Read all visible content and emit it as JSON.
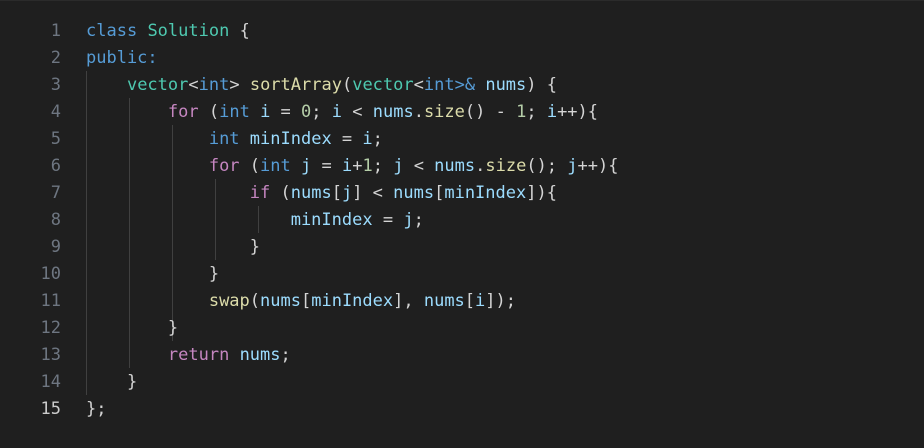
{
  "editor": {
    "language": "cpp",
    "active_line": 15,
    "lines": [
      {
        "number": "1",
        "tokens": [
          {
            "t": "class",
            "c": "kw"
          },
          {
            "t": " ",
            "c": "pun"
          },
          {
            "t": "Solution",
            "c": "typ"
          },
          {
            "t": " {",
            "c": "pun"
          }
        ]
      },
      {
        "number": "2",
        "tokens": [
          {
            "t": "public:",
            "c": "kw"
          }
        ]
      },
      {
        "number": "3",
        "tokens": [
          {
            "t": "    ",
            "c": "pun"
          },
          {
            "t": "vector",
            "c": "typ"
          },
          {
            "t": "<",
            "c": "pun"
          },
          {
            "t": "int",
            "c": "kw"
          },
          {
            "t": "> ",
            "c": "pun"
          },
          {
            "t": "sortArray",
            "c": "fn"
          },
          {
            "t": "(",
            "c": "pun"
          },
          {
            "t": "vector",
            "c": "typ"
          },
          {
            "t": "<",
            "c": "pun"
          },
          {
            "t": "int",
            "c": "kw"
          },
          {
            "t": ">&",
            "c": "kw"
          },
          {
            "t": " ",
            "c": "pun"
          },
          {
            "t": "nums",
            "c": "var"
          },
          {
            "t": ") {",
            "c": "pun"
          }
        ]
      },
      {
        "number": "4",
        "tokens": [
          {
            "t": "        ",
            "c": "pun"
          },
          {
            "t": "for",
            "c": "ctl"
          },
          {
            "t": " (",
            "c": "pun"
          },
          {
            "t": "int",
            "c": "kw"
          },
          {
            "t": " ",
            "c": "pun"
          },
          {
            "t": "i",
            "c": "var"
          },
          {
            "t": " = ",
            "c": "pun"
          },
          {
            "t": "0",
            "c": "num"
          },
          {
            "t": "; ",
            "c": "pun"
          },
          {
            "t": "i",
            "c": "var"
          },
          {
            "t": " < ",
            "c": "pun"
          },
          {
            "t": "nums",
            "c": "var"
          },
          {
            "t": ".",
            "c": "pun"
          },
          {
            "t": "size",
            "c": "fn"
          },
          {
            "t": "() - ",
            "c": "pun"
          },
          {
            "t": "1",
            "c": "num"
          },
          {
            "t": "; ",
            "c": "pun"
          },
          {
            "t": "i",
            "c": "var"
          },
          {
            "t": "++){",
            "c": "pun"
          }
        ]
      },
      {
        "number": "5",
        "tokens": [
          {
            "t": "            ",
            "c": "pun"
          },
          {
            "t": "int",
            "c": "kw"
          },
          {
            "t": " ",
            "c": "pun"
          },
          {
            "t": "minIndex",
            "c": "var"
          },
          {
            "t": " = ",
            "c": "pun"
          },
          {
            "t": "i",
            "c": "var"
          },
          {
            "t": ";",
            "c": "pun"
          }
        ]
      },
      {
        "number": "6",
        "tokens": [
          {
            "t": "            ",
            "c": "pun"
          },
          {
            "t": "for",
            "c": "ctl"
          },
          {
            "t": " (",
            "c": "pun"
          },
          {
            "t": "int",
            "c": "kw"
          },
          {
            "t": " ",
            "c": "pun"
          },
          {
            "t": "j",
            "c": "var"
          },
          {
            "t": " = ",
            "c": "pun"
          },
          {
            "t": "i",
            "c": "var"
          },
          {
            "t": "+",
            "c": "pun"
          },
          {
            "t": "1",
            "c": "num"
          },
          {
            "t": "; ",
            "c": "pun"
          },
          {
            "t": "j",
            "c": "var"
          },
          {
            "t": " < ",
            "c": "pun"
          },
          {
            "t": "nums",
            "c": "var"
          },
          {
            "t": ".",
            "c": "pun"
          },
          {
            "t": "size",
            "c": "fn"
          },
          {
            "t": "(); ",
            "c": "pun"
          },
          {
            "t": "j",
            "c": "var"
          },
          {
            "t": "++){",
            "c": "pun"
          }
        ]
      },
      {
        "number": "7",
        "tokens": [
          {
            "t": "                ",
            "c": "pun"
          },
          {
            "t": "if",
            "c": "ctl"
          },
          {
            "t": " (",
            "c": "pun"
          },
          {
            "t": "nums",
            "c": "var"
          },
          {
            "t": "[",
            "c": "pun"
          },
          {
            "t": "j",
            "c": "var"
          },
          {
            "t": "] < ",
            "c": "pun"
          },
          {
            "t": "nums",
            "c": "var"
          },
          {
            "t": "[",
            "c": "pun"
          },
          {
            "t": "minIndex",
            "c": "var"
          },
          {
            "t": "]){",
            "c": "pun"
          }
        ]
      },
      {
        "number": "8",
        "tokens": [
          {
            "t": "                    ",
            "c": "pun"
          },
          {
            "t": "minIndex",
            "c": "var"
          },
          {
            "t": " = ",
            "c": "pun"
          },
          {
            "t": "j",
            "c": "var"
          },
          {
            "t": ";",
            "c": "pun"
          }
        ]
      },
      {
        "number": "9",
        "tokens": [
          {
            "t": "                }",
            "c": "pun"
          }
        ]
      },
      {
        "number": "10",
        "tokens": [
          {
            "t": "            }",
            "c": "pun"
          }
        ]
      },
      {
        "number": "11",
        "tokens": [
          {
            "t": "            ",
            "c": "pun"
          },
          {
            "t": "swap",
            "c": "fn"
          },
          {
            "t": "(",
            "c": "pun"
          },
          {
            "t": "nums",
            "c": "var"
          },
          {
            "t": "[",
            "c": "pun"
          },
          {
            "t": "minIndex",
            "c": "var"
          },
          {
            "t": "], ",
            "c": "pun"
          },
          {
            "t": "nums",
            "c": "var"
          },
          {
            "t": "[",
            "c": "pun"
          },
          {
            "t": "i",
            "c": "var"
          },
          {
            "t": "]);",
            "c": "pun"
          }
        ]
      },
      {
        "number": "12",
        "tokens": [
          {
            "t": "        }",
            "c": "pun"
          }
        ]
      },
      {
        "number": "13",
        "tokens": [
          {
            "t": "        ",
            "c": "pun"
          },
          {
            "t": "return",
            "c": "ctl"
          },
          {
            "t": " ",
            "c": "pun"
          },
          {
            "t": "nums",
            "c": "var"
          },
          {
            "t": ";",
            "c": "pun"
          }
        ]
      },
      {
        "number": "14",
        "tokens": [
          {
            "t": "    }",
            "c": "pun"
          }
        ]
      },
      {
        "number": "15",
        "tokens": [
          {
            "t": "};",
            "c": "pun"
          }
        ]
      }
    ]
  },
  "colors": {
    "background": "#1f1f1f",
    "keyword": "#569cd6",
    "control": "#c586c0",
    "type": "#4ec9b0",
    "function": "#dcdcaa",
    "variable": "#9cdcfe",
    "number": "#b5cea8",
    "text": "#d4d4d4"
  }
}
